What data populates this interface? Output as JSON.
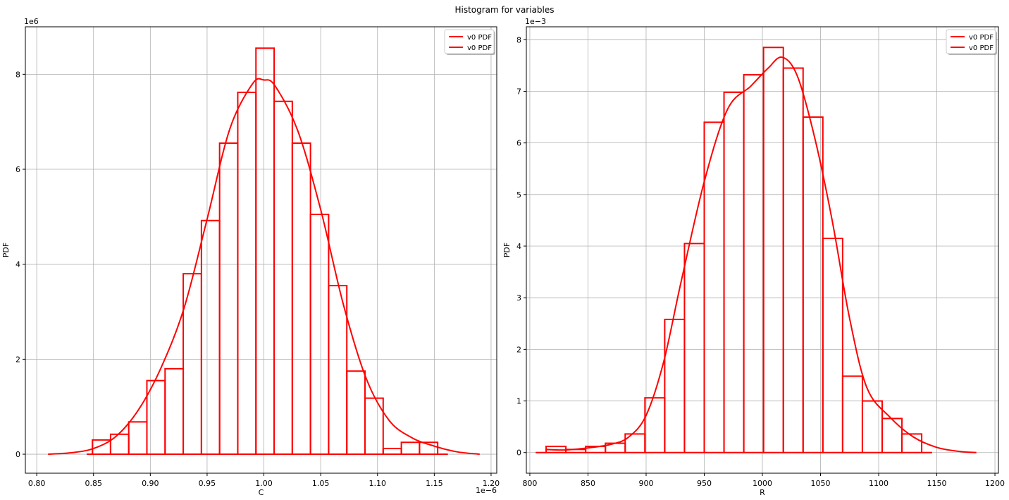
{
  "figure_title": "Histogram for variables",
  "colors": {
    "series": "#ff0000",
    "grid": "#b0b0b0",
    "axes": "#000000",
    "background": "#ffffff",
    "legend_border": "#cccccc"
  },
  "chart_data": [
    {
      "type": "histogram",
      "title": "",
      "xlabel": "C",
      "ylabel": "PDF",
      "x_offset_text": "1e−6",
      "y_offset_text": "1e6",
      "xlim": [
        0.79,
        1.205
      ],
      "ylim": [
        -0.4,
        9.0
      ],
      "x_ticks": [
        0.8,
        0.85,
        0.9,
        0.95,
        1.0,
        1.05,
        1.1,
        1.15,
        1.2
      ],
      "x_tick_labels": [
        "0.80",
        "0.85",
        "0.90",
        "0.95",
        "1.00",
        "1.05",
        "1.10",
        "1.15",
        "1.20"
      ],
      "y_ticks": [
        0,
        2,
        4,
        6,
        8
      ],
      "y_tick_labels": [
        "0",
        "2",
        "4",
        "6",
        "8"
      ],
      "grid": true,
      "legend_position": "top-right",
      "legend": [
        "v0 PDF",
        "v0 PDF"
      ],
      "bin_edges": [
        0.849,
        0.865,
        0.881,
        0.897,
        0.913,
        0.929,
        0.945,
        0.961,
        0.977,
        0.993,
        1.009,
        1.025,
        1.041,
        1.057,
        1.073,
        1.089,
        1.105,
        1.121,
        1.137,
        1.153
      ],
      "bin_heights": [
        0.3,
        0.42,
        0.68,
        1.55,
        1.8,
        3.8,
        4.92,
        6.55,
        7.62,
        8.55,
        7.43,
        6.55,
        5.05,
        3.55,
        1.75,
        1.18,
        0.12,
        0.25,
        0.25
      ],
      "step_start_x": 0.844,
      "step_end_x": 1.162,
      "curve_x": [
        0.81,
        0.83,
        0.85,
        0.87,
        0.89,
        0.91,
        0.93,
        0.95,
        0.97,
        0.99,
        1.0,
        1.01,
        1.03,
        1.05,
        1.07,
        1.09,
        1.11,
        1.13,
        1.15,
        1.17,
        1.19
      ],
      "curve_y": [
        0.0,
        0.03,
        0.12,
        0.38,
        0.95,
        1.85,
        3.1,
        4.95,
        6.85,
        7.8,
        7.88,
        7.75,
        6.8,
        5.15,
        3.15,
        1.6,
        0.72,
        0.35,
        0.17,
        0.05,
        0.0
      ]
    },
    {
      "type": "histogram",
      "title": "",
      "xlabel": "R",
      "ylabel": "PDF",
      "x_offset_text": "",
      "y_offset_text": "1e−3",
      "xlim": [
        797,
        1203
      ],
      "ylim": [
        -0.4,
        8.25
      ],
      "x_ticks": [
        800,
        850,
        900,
        950,
        1000,
        1050,
        1100,
        1150,
        1200
      ],
      "x_tick_labels": [
        "800",
        "850",
        "900",
        "950",
        "1000",
        "1050",
        "1100",
        "1150",
        "1200"
      ],
      "y_ticks": [
        0,
        1,
        2,
        3,
        4,
        5,
        6,
        7,
        8
      ],
      "y_tick_labels": [
        "0",
        "1",
        "2",
        "3",
        "4",
        "5",
        "6",
        "7",
        "8"
      ],
      "grid": true,
      "legend_position": "top-right",
      "legend": [
        "v0 PDF",
        "v0 PDF"
      ],
      "bin_edges": [
        814,
        831,
        848,
        865,
        882,
        899,
        916,
        933,
        950,
        967,
        984,
        1001,
        1018,
        1035,
        1052,
        1069,
        1086,
        1103,
        1120,
        1137
      ],
      "bin_heights": [
        0.12,
        0.06,
        0.12,
        0.18,
        0.36,
        1.06,
        2.58,
        4.05,
        6.4,
        6.98,
        7.32,
        7.85,
        7.45,
        6.5,
        4.15,
        1.48,
        1.0,
        0.66,
        0.36
      ],
      "step_start_x": 805,
      "step_end_x": 1146,
      "curve_x": [
        814,
        830,
        850,
        870,
        885,
        900,
        915,
        930,
        950,
        970,
        990,
        1005,
        1017,
        1030,
        1045,
        1060,
        1075,
        1090,
        1110,
        1130,
        1150,
        1170,
        1184
      ],
      "curve_y": [
        0.06,
        0.05,
        0.09,
        0.16,
        0.3,
        0.72,
        1.75,
        3.3,
        5.25,
        6.65,
        7.1,
        7.45,
        7.66,
        7.3,
        6.1,
        4.5,
        2.6,
        1.25,
        0.68,
        0.3,
        0.1,
        0.02,
        0.0
      ]
    }
  ]
}
